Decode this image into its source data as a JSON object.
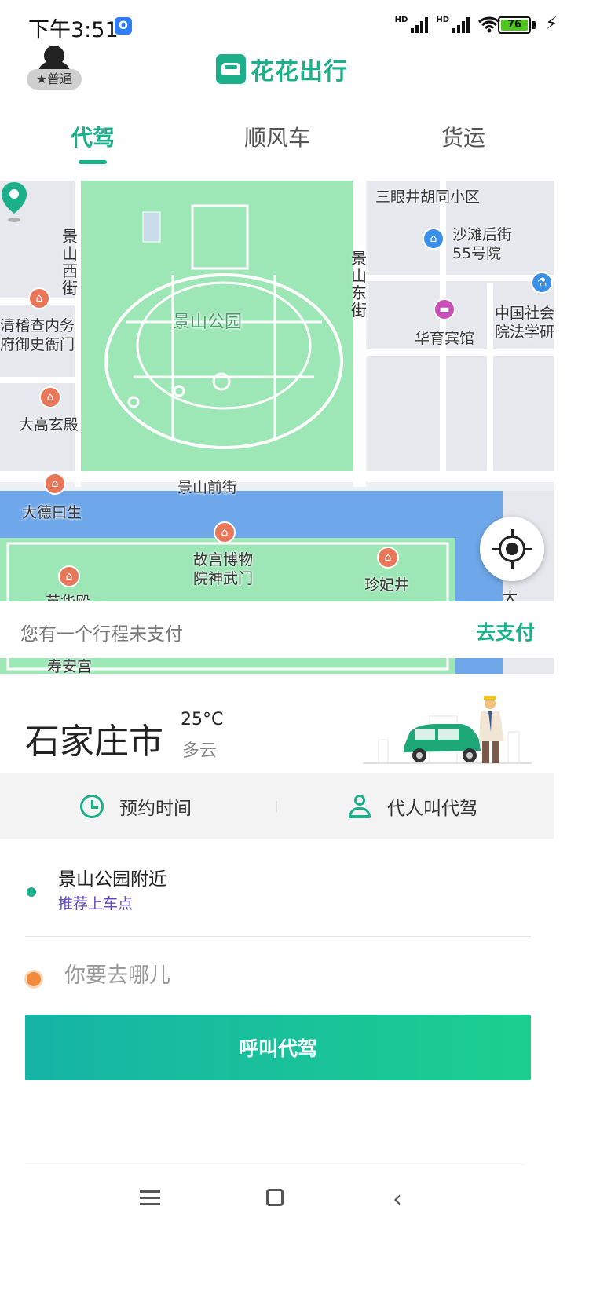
{
  "status_bar": {
    "time": "下午3:51",
    "badge": "O",
    "hd1": "HD",
    "hd2": "HD",
    "wifi_sub": "6",
    "battery": "76"
  },
  "header": {
    "user_level": "★普通",
    "brand": "花花出行"
  },
  "tabs": [
    {
      "label": "代驾",
      "active": true
    },
    {
      "label": "顺风车",
      "active": false
    },
    {
      "label": "货运",
      "active": false
    }
  ],
  "map": {
    "park_label": "景山公园",
    "labels": {
      "sanyanjing": "三眼井胡同小区",
      "shatan": "沙滩后街",
      "shatan2": "55号院",
      "huayu": "华育宾馆",
      "shehui1": "中国社会",
      "shehui2": "院法学研",
      "qingji1": "清稽查内务",
      "qingji2": "府御史衙门",
      "dagao": "大高玄殿",
      "jingshanqian": "景山前街",
      "dade": "大德曰生",
      "gugong1": "故宫博物",
      "gugong2": "院神武门",
      "zhenfei": "珍妃井",
      "yinghua": "英华殿",
      "shouan": "寿安宫",
      "da": "大",
      "jingshanxi": "景山西街",
      "jingshandong": "景山东街"
    },
    "colors": {
      "park": "#9de6b5",
      "water": "#6fa8ea",
      "road": "#ffffff",
      "pin": "#1bb08a"
    }
  },
  "unpaid": {
    "text": "您有一个行程未支付",
    "action": "去支付"
  },
  "weather": {
    "city": "石家庄市",
    "temp": "25°C",
    "desc": "多云"
  },
  "options": {
    "schedule": "预约时间",
    "for_others": "代人叫代驾"
  },
  "trip": {
    "from": "景山公园附近",
    "from_hint": "推荐上车点",
    "to_placeholder": "你要去哪儿",
    "call_button": "呼叫代驾"
  },
  "accent": "#1bb08a"
}
